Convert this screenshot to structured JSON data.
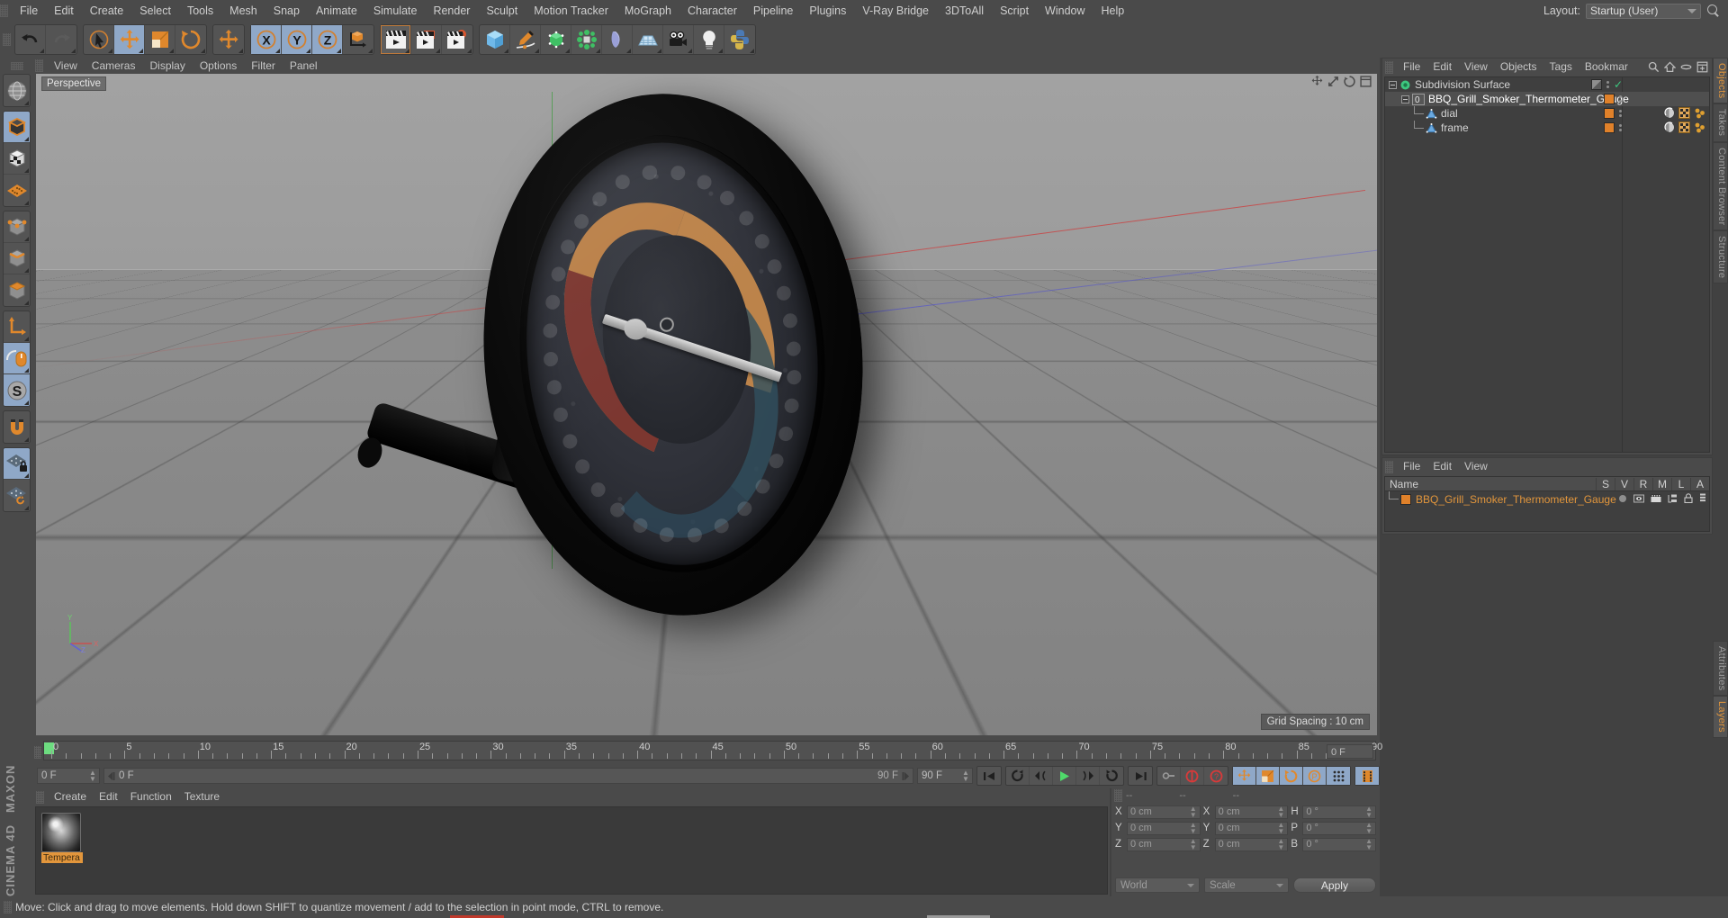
{
  "app": {
    "name": "Cinema 4D",
    "brand_top": "MAXON",
    "brand_bottom": "CINEMA 4D"
  },
  "menubar": {
    "items": [
      "File",
      "Edit",
      "Create",
      "Select",
      "Tools",
      "Mesh",
      "Snap",
      "Animate",
      "Simulate",
      "Render",
      "Sculpt",
      "Motion Tracker",
      "MoGraph",
      "Character",
      "Pipeline",
      "Plugins",
      "V-Ray Bridge",
      "3DToAll",
      "Script",
      "Window",
      "Help"
    ],
    "layout_label": "Layout:",
    "layout_value": "Startup (User)",
    "search_icon": "magnifier-icon"
  },
  "toolbar": {
    "groups": [
      {
        "name": "history",
        "buttons": [
          {
            "name": "undo-button",
            "icon": "undo-arrow-icon",
            "state": "normal"
          },
          {
            "name": "redo-button",
            "icon": "redo-arrow-icon",
            "state": "disabled"
          }
        ]
      },
      {
        "name": "transform-tools",
        "buttons": [
          {
            "name": "live-selection-tool",
            "icon": "cursor-circle-icon",
            "state": "normal"
          },
          {
            "name": "move-tool",
            "icon": "move-arrows-icon",
            "state": "active"
          },
          {
            "name": "scale-tool",
            "icon": "scale-box-icon",
            "state": "normal"
          },
          {
            "name": "rotate-tool",
            "icon": "rotate-circle-icon",
            "state": "normal"
          }
        ]
      },
      {
        "name": "world-move",
        "buttons": [
          {
            "name": "world-move-tool",
            "icon": "move-arrows-icon",
            "state": "normal"
          }
        ]
      },
      {
        "name": "axis-locks",
        "buttons": [
          {
            "name": "lock-x-axis",
            "icon": "axis-x-icon",
            "label": "X",
            "state": "active"
          },
          {
            "name": "lock-y-axis",
            "icon": "axis-y-icon",
            "label": "Y",
            "state": "active"
          },
          {
            "name": "lock-z-axis",
            "icon": "axis-z-icon",
            "label": "Z",
            "state": "active"
          },
          {
            "name": "world-object-coordinate-toggle",
            "icon": "world-axis-cube-icon",
            "state": "normal"
          }
        ]
      },
      {
        "name": "render-group",
        "buttons": [
          {
            "name": "render-view-button",
            "icon": "clapperboard-icon",
            "state": "selected"
          },
          {
            "name": "render-to-picture-viewer-button",
            "icon": "clapperboard-frame-icon",
            "state": "normal"
          },
          {
            "name": "render-settings-button",
            "icon": "clapperboard-gear-icon",
            "state": "normal"
          }
        ]
      },
      {
        "name": "creation-group",
        "buttons": [
          {
            "name": "add-primitive-button",
            "icon": "cube-icon",
            "state": "normal"
          },
          {
            "name": "spline-pen-button",
            "icon": "pen-spline-icon",
            "state": "normal"
          },
          {
            "name": "generator-button",
            "icon": "subdivision-cube-icon",
            "state": "normal"
          },
          {
            "name": "mograph-cloner-button",
            "icon": "cloner-icon",
            "state": "normal"
          },
          {
            "name": "deformer-button",
            "icon": "bend-deformer-icon",
            "state": "normal"
          },
          {
            "name": "scene-object-button",
            "icon": "floor-grid-icon",
            "state": "normal"
          },
          {
            "name": "camera-button",
            "icon": "camera-icon",
            "state": "normal"
          },
          {
            "name": "light-button",
            "icon": "light-bulb-icon",
            "state": "normal"
          },
          {
            "name": "python-button",
            "icon": "python-icon",
            "state": "normal"
          }
        ]
      }
    ]
  },
  "left_toolbar": {
    "groups": [
      [
        {
          "name": "make-editable-button",
          "icon": "globe-wire-icon",
          "state": "normal"
        }
      ],
      [
        {
          "name": "model-mode-button",
          "icon": "model-cube-icon",
          "state": "active"
        },
        {
          "name": "texture-mode-button",
          "icon": "checker-cube-icon",
          "state": "normal"
        },
        {
          "name": "uv-polygon-mode-button",
          "icon": "uv-mesh-icon",
          "state": "normal"
        }
      ],
      [
        {
          "name": "point-mode-button",
          "icon": "points-cube-icon",
          "state": "normal"
        },
        {
          "name": "edge-mode-button",
          "icon": "edge-cube-icon",
          "state": "normal"
        },
        {
          "name": "polygon-mode-button",
          "icon": "polygon-cube-icon",
          "state": "normal"
        }
      ],
      [
        {
          "name": "enable-axis-modification-button",
          "icon": "axis-l-icon",
          "state": "normal"
        },
        {
          "name": "viewport-solo-button",
          "icon": "mouse-icon",
          "state": "active"
        },
        {
          "name": "snap-settings-button",
          "icon": "snap-s-icon",
          "state": "active"
        }
      ],
      [
        {
          "name": "workplane-magnet-button",
          "icon": "magnet-icon",
          "state": "normal"
        }
      ],
      [
        {
          "name": "lock-workplane-button",
          "icon": "grid-lock-icon",
          "state": "active"
        },
        {
          "name": "planar-workplane-button",
          "icon": "grid-rotate-icon",
          "state": "normal"
        }
      ]
    ]
  },
  "viewport": {
    "menu": [
      "View",
      "Cameras",
      "Display",
      "Options",
      "Filter",
      "Panel"
    ],
    "label": "Perspective",
    "grid_spacing": "Grid Spacing : 10 cm",
    "nav_icons": [
      "move-view-icon",
      "scale-view-icon",
      "rotate-view-icon",
      "maximize-view-icon"
    ],
    "axis_gizmo": {
      "x": "X",
      "y": "Y",
      "z": "Z"
    },
    "scene": {
      "object": "BBQ Grill Smoker Thermometer Gauge",
      "colors": {
        "sky": "#a0a0a0",
        "ground": "#888888",
        "bezel": "#0a0a0a",
        "dial_face": "#33353c",
        "arc_orange": "#c08449",
        "arc_red": "#7a3430",
        "arc_blue": "#2f4858",
        "needle": "#cfcfcf",
        "axis_x": "#c84646",
        "axis_y": "#4f9f4f",
        "axis_z": "#5050d2"
      }
    }
  },
  "object_manager": {
    "menu": [
      "File",
      "Edit",
      "View",
      "Objects",
      "Tags",
      "Bookmar"
    ],
    "icons": [
      "search-icon",
      "home-icon",
      "ellipse-icon",
      "new-window-icon"
    ],
    "rows": [
      {
        "name": "Subdivision Surface",
        "depth": 0,
        "icon": "subdivision-surface-icon",
        "color": "#3dc77f",
        "tag_color": "#7a7a7a",
        "check": true,
        "has_tags": false,
        "selected": false
      },
      {
        "name": "BBQ_Grill_Smoker_Thermometer_Gauge",
        "depth": 1,
        "icon": "null-object-icon",
        "color": "#cfcfcf",
        "tag_color": "#e0812a",
        "check": false,
        "has_tags": false,
        "selected": true
      },
      {
        "name": "dial",
        "depth": 2,
        "icon": "polygon-object-icon",
        "color": "#6aa9e0",
        "tag_color": "#e0812a",
        "check": false,
        "has_tags": true,
        "selected": false
      },
      {
        "name": "frame",
        "depth": 2,
        "icon": "polygon-object-icon",
        "color": "#6aa9e0",
        "tag_color": "#e0812a",
        "check": false,
        "has_tags": true,
        "selected": false
      }
    ],
    "tabs": [
      "Objects",
      "Takes",
      "Content Browser",
      "Structure"
    ],
    "active_tab": "Objects"
  },
  "layer_manager": {
    "menu": [
      "File",
      "Edit",
      "View"
    ],
    "columns": [
      "Name",
      "S",
      "V",
      "R",
      "M",
      "L",
      "A"
    ],
    "rows": [
      {
        "name": "BBQ_Grill_Smoker_Thermometer_Gauge",
        "color": "#e0812a"
      }
    ],
    "tabs": [
      "Attributes",
      "Layers"
    ],
    "active_tab": "Layers"
  },
  "timeline": {
    "ticks": [
      0,
      5,
      10,
      15,
      20,
      25,
      30,
      35,
      40,
      45,
      50,
      55,
      60,
      65,
      70,
      75,
      80,
      85,
      90
    ],
    "current_frame_marker": 0,
    "end_field": "0 F"
  },
  "transport": {
    "current_frame": "0 F",
    "track_frame": "0 F",
    "preview_end": "90 F",
    "end_frame": "90 F",
    "buttons": [
      {
        "name": "go-to-start-button",
        "icon": "skip-start-icon"
      },
      {
        "name": "go-to-previous-key-button",
        "icon": "prev-key-icon"
      },
      {
        "name": "step-back-button",
        "icon": "step-back-icon"
      },
      {
        "name": "play-button",
        "icon": "play-icon"
      },
      {
        "name": "step-forward-button",
        "icon": "step-forward-icon"
      },
      {
        "name": "go-to-next-key-button",
        "icon": "next-key-icon"
      },
      {
        "name": "go-to-end-button",
        "icon": "skip-end-icon"
      },
      {
        "name": "record-active-objects-button",
        "icon": "key-icon"
      },
      {
        "name": "autokeying-button",
        "icon": "autokey-circle-icon"
      },
      {
        "name": "keyframe-selection-button",
        "icon": "question-circle-icon"
      },
      {
        "name": "position-key-button",
        "icon": "move-arrows-icon"
      },
      {
        "name": "scale-key-button",
        "icon": "scale-box-icon"
      },
      {
        "name": "rotation-key-button",
        "icon": "rotate-circle-icon"
      },
      {
        "name": "parameter-key-button",
        "icon": "param-p-icon"
      },
      {
        "name": "point-level-animation-button",
        "icon": "point-grid-icon"
      },
      {
        "name": "timeline-strip-button",
        "icon": "filmstrip-icon"
      }
    ]
  },
  "material_manager": {
    "menu": [
      "Create",
      "Edit",
      "Function",
      "Texture"
    ],
    "materials": [
      {
        "name": "Tempera",
        "full_name": "Temperature",
        "icon": "material-sphere-icon",
        "selected": true
      }
    ]
  },
  "coordinate_manager": {
    "header_placeholders": [
      "--",
      "--",
      "--"
    ],
    "position": [
      {
        "label": "X",
        "value": "0 cm"
      },
      {
        "label": "Y",
        "value": "0 cm"
      },
      {
        "label": "Z",
        "value": "0 cm"
      }
    ],
    "size": [
      {
        "label": "X",
        "value": "0 cm"
      },
      {
        "label": "Y",
        "value": "0 cm"
      },
      {
        "label": "Z",
        "value": "0 cm"
      }
    ],
    "rotation": [
      {
        "label": "H",
        "value": "0 °"
      },
      {
        "label": "P",
        "value": "0 °"
      },
      {
        "label": "B",
        "value": "0 °"
      }
    ],
    "coord_system": "World",
    "size_mode": "Scale",
    "apply_label": "Apply"
  },
  "status_bar": {
    "message": "Move: Click and drag to move elements. Hold down SHIFT to quantize movement / add to the selection in point mode, CTRL to remove."
  }
}
